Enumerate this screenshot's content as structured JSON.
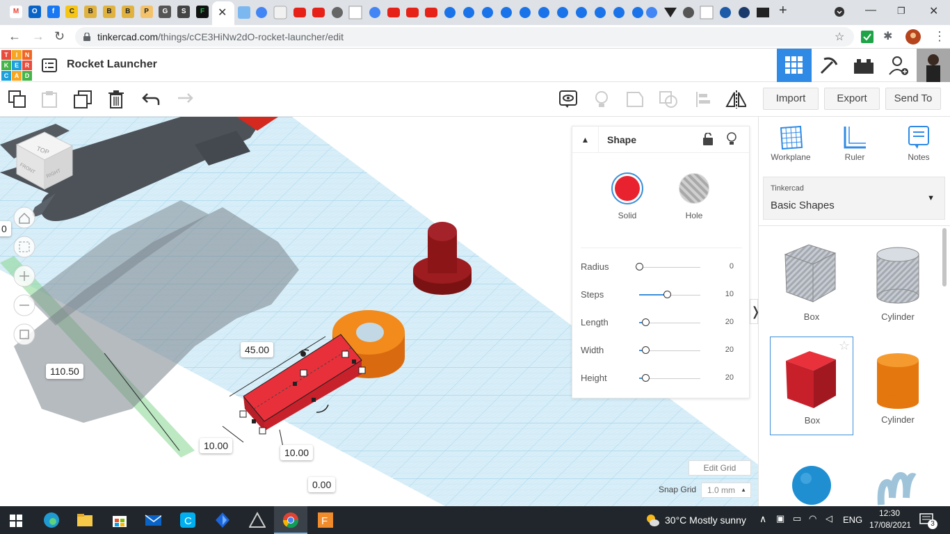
{
  "browser": {
    "tab_favicons": [
      {
        "name": "gmail-icon",
        "glyph": "M",
        "color": "#ea4335",
        "bg": "#ffffff"
      },
      {
        "name": "outlook-icon",
        "glyph": "O",
        "color": "#ffffff",
        "bg": "#0a64c8"
      },
      {
        "name": "facebook-icon",
        "glyph": "f",
        "color": "#ffffff",
        "bg": "#1877f2"
      },
      {
        "name": "coin-icon",
        "glyph": "C",
        "color": "#222",
        "bg": "#f5c518"
      },
      {
        "name": "bank-icon",
        "glyph": "B",
        "color": "#222",
        "bg": "#e0b240"
      },
      {
        "name": "bank-icon",
        "glyph": "B",
        "color": "#222",
        "bg": "#e0b240"
      },
      {
        "name": "bank-icon",
        "glyph": "B",
        "color": "#222",
        "bg": "#e0b240"
      },
      {
        "name": "person-icon",
        "glyph": "P",
        "color": "#222",
        "bg": "#f4c26b"
      },
      {
        "name": "globe-icon",
        "glyph": "G",
        "color": "#fff",
        "bg": "#555555"
      },
      {
        "name": "shield-icon",
        "glyph": "S",
        "color": "#fff",
        "bg": "#444444"
      },
      {
        "name": "feedly-icon",
        "glyph": "F",
        "color": "#2bb24c",
        "bg": "#111111"
      }
    ],
    "active_tab_close": "✕",
    "url_host": "tinkercad.com",
    "url_path": "/things/cCE3HiNw2dO-rocket-launcher/edit"
  },
  "header": {
    "logo_letters": [
      "T",
      "I",
      "N",
      "K",
      "E",
      "R",
      "C",
      "A",
      "D"
    ],
    "title": "Rocket Launcher"
  },
  "toolbar": {
    "import_label": "Import",
    "export_label": "Export",
    "send_to_label": "Send To"
  },
  "inspector": {
    "title": "Shape",
    "solid_label": "Solid",
    "hole_label": "Hole",
    "solid_color": "#e8232f",
    "props": [
      {
        "label": "Radius",
        "value": "0",
        "level": 0.0
      },
      {
        "label": "Steps",
        "value": "10",
        "level": 0.45
      },
      {
        "label": "Length",
        "value": "20",
        "level": 0.1
      },
      {
        "label": "Width",
        "value": "20",
        "level": 0.1
      },
      {
        "label": "Height",
        "value": "20",
        "level": 0.1
      }
    ]
  },
  "viewport": {
    "dim_length": "45.00",
    "dim_offset": "110.50",
    "dim_width": "10.00",
    "dim_height": "10.00",
    "dim_elev": "0.00",
    "dim_left": "0",
    "edit_grid": "Edit Grid",
    "snap_label": "Snap Grid",
    "snap_value": "1.0 mm",
    "viewcube_top": "TOP",
    "viewcube_front": "FRONT",
    "viewcube_right": "RIGHT"
  },
  "rpanel": {
    "workplane": "Workplane",
    "ruler": "Ruler",
    "notes": "Notes",
    "library_group": "Tinkercad",
    "library_name": "Basic Shapes",
    "shapes": [
      {
        "label": "Box",
        "kind": "box-hole"
      },
      {
        "label": "Cylinder",
        "kind": "cyl-hole"
      },
      {
        "label": "Box",
        "kind": "box-red"
      },
      {
        "label": "Cylinder",
        "kind": "cyl-orange"
      }
    ]
  },
  "taskbar": {
    "weather": "30°C  Mostly sunny",
    "lang": "ENG",
    "time": "12:30",
    "date": "17/08/2021",
    "notif_count": "3"
  }
}
